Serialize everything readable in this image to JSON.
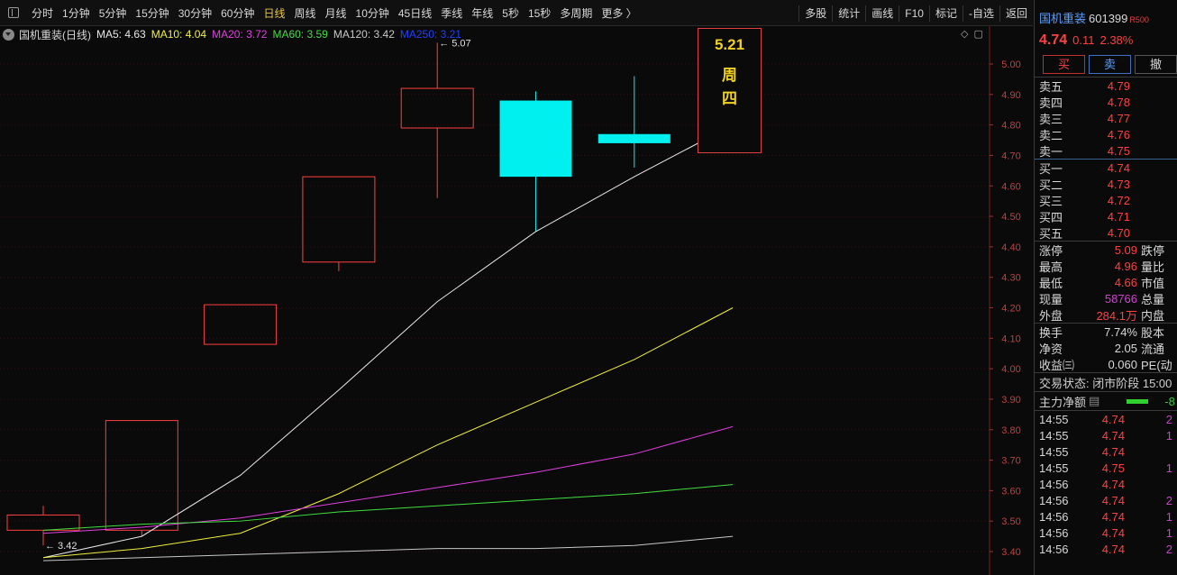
{
  "toolbar": {
    "periods": [
      "分时",
      "1分钟",
      "5分钟",
      "15分钟",
      "30分钟",
      "60分钟",
      "日线",
      "周线",
      "月线",
      "10分钟",
      "45日线",
      "季线",
      "年线",
      "5秒",
      "15秒",
      "多周期",
      "更多 〉"
    ],
    "active_period": "日线",
    "tools": [
      "多股",
      "统计",
      "画线",
      "F10",
      "标记",
      "-自选",
      "返回"
    ]
  },
  "legend": {
    "title": "国机重装(日线)",
    "ma": [
      {
        "label": "MA5: 4.63",
        "color": "#e8e8e8"
      },
      {
        "label": "MA10: 4.04",
        "color": "#f0f040"
      },
      {
        "label": "MA20: 3.72",
        "color": "#e040e0"
      },
      {
        "label": "MA60: 3.59",
        "color": "#40e040"
      },
      {
        "label": "MA120: 3.42",
        "color": "#c8c8c8"
      },
      {
        "label": "MA250: 3.21",
        "color": "#2040ff"
      }
    ]
  },
  "date_tip": {
    "date": "5.21",
    "weekday_1": "周",
    "weekday_2": "四"
  },
  "chart_data": {
    "type": "candlestick",
    "y_ticks": [
      "5.00",
      "4.90",
      "4.80",
      "4.70",
      "4.60",
      "4.50",
      "4.40",
      "4.30",
      "4.20",
      "4.10",
      "4.00",
      "3.90",
      "3.80",
      "3.70",
      "3.60",
      "3.50",
      "3.40"
    ],
    "ylim": [
      3.35,
      5.12
    ],
    "candles": [
      {
        "open": 3.47,
        "close": 3.52,
        "high": 3.55,
        "low": 3.42,
        "color": "up"
      },
      {
        "open": 3.47,
        "close": 3.83,
        "high": 3.83,
        "low": 3.45,
        "color": "up"
      },
      {
        "open": 4.08,
        "close": 4.21,
        "high": 4.21,
        "low": 4.08,
        "color": "up"
      },
      {
        "open": 4.35,
        "close": 4.63,
        "high": 4.63,
        "low": 4.32,
        "color": "up"
      },
      {
        "open": 4.79,
        "close": 4.92,
        "high": 5.07,
        "low": 4.56,
        "color": "up"
      },
      {
        "open": 4.88,
        "close": 4.63,
        "high": 4.91,
        "low": 4.45,
        "color": "down"
      },
      {
        "open": 4.77,
        "close": 4.74,
        "high": 4.96,
        "low": 4.66,
        "color": "down"
      }
    ],
    "annotations": [
      {
        "label": "5.07",
        "price": 5.07,
        "candle": 4
      },
      {
        "label": "3.42",
        "price": 3.42,
        "candle": 0
      }
    ],
    "ma_lines": [
      {
        "name": "MA5",
        "color": "#e8e8e8",
        "values": [
          3.38,
          3.45,
          3.65,
          3.93,
          4.22,
          4.45,
          4.63,
          4.8
        ]
      },
      {
        "name": "MA10",
        "color": "#f0f040",
        "values": [
          3.38,
          3.41,
          3.46,
          3.59,
          3.75,
          3.89,
          4.03,
          4.2
        ]
      },
      {
        "name": "MA20",
        "color": "#e040e0",
        "values": [
          3.46,
          3.48,
          3.51,
          3.56,
          3.61,
          3.66,
          3.72,
          3.81
        ]
      },
      {
        "name": "MA60",
        "color": "#40e040",
        "values": [
          3.47,
          3.49,
          3.5,
          3.53,
          3.55,
          3.57,
          3.59,
          3.62
        ]
      },
      {
        "name": "MA120",
        "color": "#c8c8c8",
        "values": [
          3.37,
          3.38,
          3.39,
          3.4,
          3.41,
          3.41,
          3.42,
          3.45
        ]
      }
    ]
  },
  "quote": {
    "name": "国机重装",
    "code": "601399",
    "tag": "R500",
    "price": "4.74",
    "change": "0.11",
    "change_pct": "2.38%",
    "buttons": {
      "buy": "买",
      "sell": "卖",
      "cancel": "撤"
    },
    "asks": [
      {
        "label": "卖五",
        "price": "4.79"
      },
      {
        "label": "卖四",
        "price": "4.78"
      },
      {
        "label": "卖三",
        "price": "4.77"
      },
      {
        "label": "卖二",
        "price": "4.76"
      },
      {
        "label": "卖一",
        "price": "4.75"
      }
    ],
    "bids": [
      {
        "label": "买一",
        "price": "4.74"
      },
      {
        "label": "买二",
        "price": "4.73"
      },
      {
        "label": "买三",
        "price": "4.72"
      },
      {
        "label": "买四",
        "price": "4.71"
      },
      {
        "label": "买五",
        "price": "4.70"
      }
    ],
    "stats1": [
      {
        "label": "涨停",
        "value": "5.09",
        "label2": "跌停",
        "cls": "red"
      },
      {
        "label": "最高",
        "value": "4.96",
        "label2": "量比",
        "cls": "red"
      },
      {
        "label": "最低",
        "value": "4.66",
        "label2": "市值",
        "cls": "red"
      },
      {
        "label": "现量",
        "value": "58766",
        "label2": "总量",
        "cls": "magenta"
      },
      {
        "label": "外盘",
        "value": "284.1万",
        "label2": "内盘",
        "cls": "red"
      }
    ],
    "stats2": [
      {
        "label": "换手",
        "value": "7.74%",
        "label2": "股本"
      },
      {
        "label": "净资",
        "value": "2.05",
        "label2": "流通"
      },
      {
        "label": "收益㈢",
        "value": "0.060",
        "label2": "PE(动"
      }
    ],
    "trade_status": "交易状态: 闭市阶段 15:00",
    "flow_label": "主力净额",
    "flow_value": "-8",
    "ticks": [
      {
        "time": "14:55",
        "price": "4.74",
        "qty": "2",
        "cls": "magenta"
      },
      {
        "time": "14:55",
        "price": "4.74",
        "qty": "1",
        "cls": "magenta"
      },
      {
        "time": "14:55",
        "price": "4.74",
        "qty": "",
        "cls": "magenta"
      },
      {
        "time": "14:55",
        "price": "4.75",
        "qty": "1",
        "cls": "magenta"
      },
      {
        "time": "14:56",
        "price": "4.74",
        "qty": "",
        "cls": "magenta"
      },
      {
        "time": "14:56",
        "price": "4.74",
        "qty": "2",
        "cls": "magenta"
      },
      {
        "time": "14:56",
        "price": "4.74",
        "qty": "1",
        "cls": "magenta"
      },
      {
        "time": "14:56",
        "price": "4.74",
        "qty": "1",
        "cls": "magenta"
      },
      {
        "time": "14:56",
        "price": "4.74",
        "qty": "2",
        "cls": "magenta"
      }
    ]
  }
}
